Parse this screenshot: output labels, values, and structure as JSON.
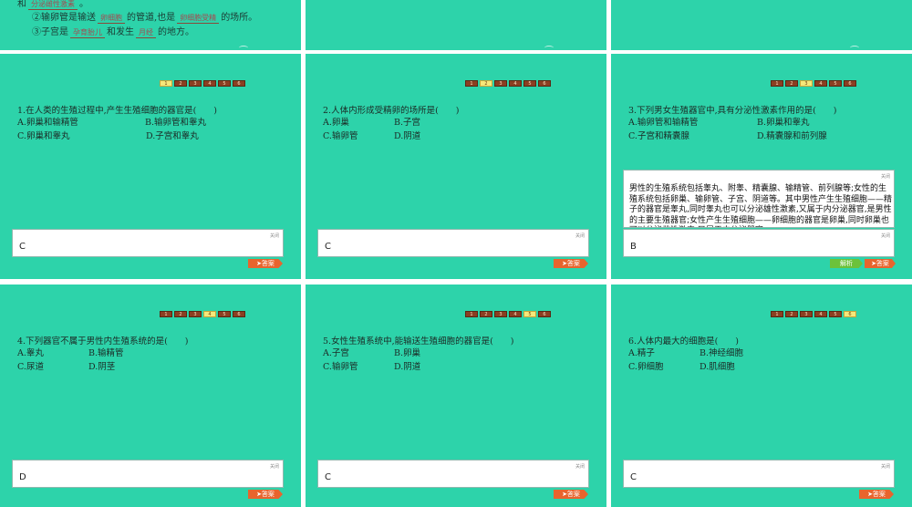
{
  "top_row": {
    "left": {
      "line1_prefix": "和",
      "line1_blank": "分泌雌性激素",
      "line1_suffix": "。",
      "line2_prefix": "②输卵管是输送",
      "line2_blank1": "卵细胞",
      "line2_mid": "的管道,也是",
      "line2_blank2": "卵细胞受精",
      "line2_suffix": "的场所。",
      "line3_prefix": "③子宫是",
      "line3_blank1": "孕育胎儿",
      "line3_mid": "和发生",
      "line3_blank2": "月经",
      "line3_suffix": "的地方。"
    }
  },
  "pages": [
    "1",
    "2",
    "3",
    "4",
    "5",
    "6"
  ],
  "close_label": "关闭",
  "answer_label": "➤答案",
  "jiexi_label": "解析",
  "slides": [
    {
      "question": "1.在人类的生殖过程中,产生生殖细胞的器官是(　　)",
      "options": {
        "A": "A.卵巢和输精管",
        "B": "B.输卵管和睾丸",
        "C": "C.卵巢和睾丸",
        "D": "D.子宫和睾丸"
      },
      "answer": "C"
    },
    {
      "question": "2.人体内形成受精卵的场所是(　　)",
      "options": {
        "A": "A.卵巢",
        "B": "B.子宫",
        "C": "C.输卵管",
        "D": "D.阴道"
      },
      "answer": "C"
    },
    {
      "question": "3.下列男女生殖器官中,具有分泌性激素作用的是(　　)",
      "options": {
        "A": "A.输卵管和输精管",
        "B": "B.卵巢和睾丸",
        "C": "C.子宫和精囊腺",
        "D": "D.精囊腺和前列腺"
      },
      "answer": "B",
      "explanation": "男性的生殖系统包括睾丸、附睾、精囊腺、输精管、前列腺等;女性的生殖系统包括卵巢、输卵管、子宫、阴道等。其中男性产生生殖细胞——精子的器官是睾丸,同时睾丸也可以分泌雄性激素,又属于内分泌器官,是男性的主要生殖器官;女性产生生殖细胞——卵细胞的器官是卵巢,同时卵巢也可以分泌雌性激素,又属于内分泌器官"
    },
    {
      "question": "4.下列器官不属于男性内生殖系统的是(　　)",
      "options": {
        "A": "A.睾丸",
        "B": "B.输精管",
        "C": "C.尿道",
        "D": "D.阴茎"
      },
      "answer": "D"
    },
    {
      "question": "5.女性生殖系统中,能输送生殖细胞的器官是(　　)",
      "options": {
        "A": "A.子宫",
        "B": "B.卵巢",
        "C": "C.输卵管",
        "D": "D.阴道"
      },
      "answer": "C"
    },
    {
      "question": "6.人体内最大的细胞是(　　)",
      "options": {
        "A": "A.精子",
        "B": "B.神经细胞",
        "C": "C.卵细胞",
        "D": "D.肌细胞"
      },
      "answer": "C"
    }
  ]
}
